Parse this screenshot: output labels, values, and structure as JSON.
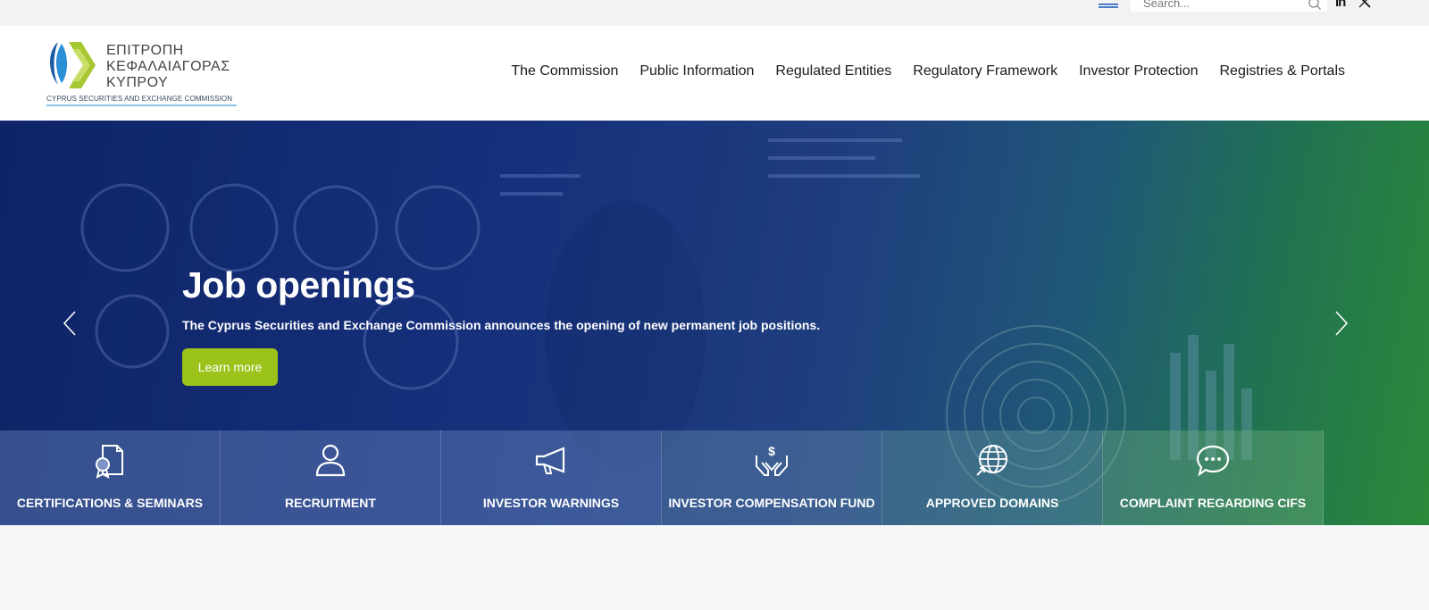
{
  "topbar": {
    "search_placeholder": "Search...",
    "linkedin": "in"
  },
  "logo": {
    "line1": "ΕΠΙΤΡΟΠΗ",
    "line2": "ΚΕΦΑΛΑΙΑΓΟΡΑΣ",
    "line3": "ΚΥΠΡΟΥ",
    "subtitle": "CYPRUS SECURITIES AND EXCHANGE COMMISSION"
  },
  "nav": {
    "items": [
      "The Commission",
      "Public Information",
      "Regulated Entities",
      "Regulatory Framework",
      "Investor Protection",
      "Registries & Portals"
    ]
  },
  "hero": {
    "title": "Job openings",
    "text": "The Cyprus Securities and Exchange Commission announces the opening of new permanent job positions.",
    "button": "Learn more"
  },
  "quick_links": [
    {
      "label": "CERTIFICATIONS & SEMINARS",
      "icon": "certificate-icon"
    },
    {
      "label": "RECRUITMENT",
      "icon": "user-icon"
    },
    {
      "label": "INVESTOR WARNINGS",
      "icon": "megaphone-icon"
    },
    {
      "label": "INVESTOR COMPENSATION FUND",
      "icon": "hands-dollar-icon"
    },
    {
      "label": "APPROVED DOMAINS",
      "icon": "globe-icon"
    },
    {
      "label": "COMPLAINT REGARDING CIFS",
      "icon": "chat-bubble-icon"
    }
  ],
  "colors": {
    "accent_green": "#9cc31a",
    "hero_blue": "#0e2466",
    "hero_green": "#2b8a3a"
  }
}
